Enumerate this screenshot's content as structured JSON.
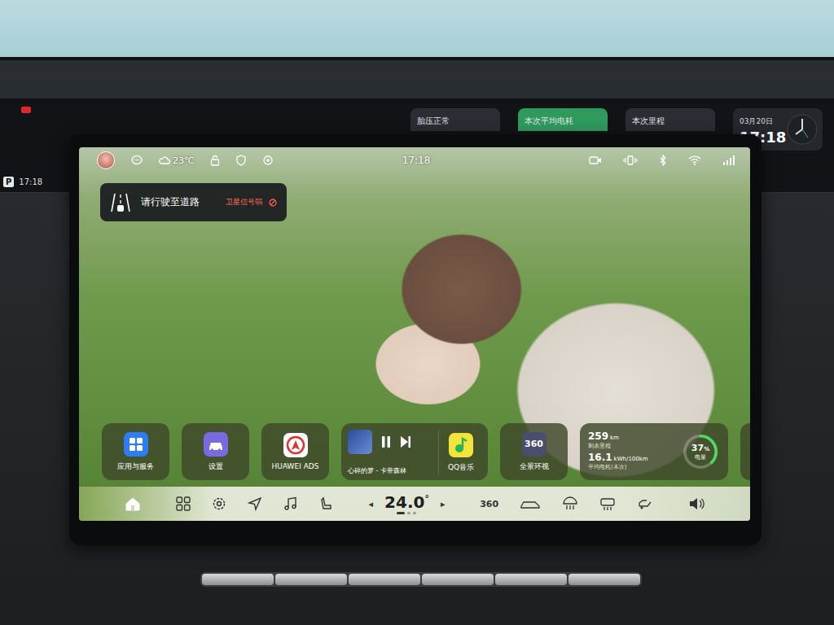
{
  "cluster": {
    "gear": "P",
    "time": "17:18",
    "widgets": [
      {
        "label": "胎压正常",
        "highlight": false
      },
      {
        "label": "本次平均电耗",
        "highlight": true
      },
      {
        "label": "本次里程",
        "highlight": false
      }
    ],
    "date": "03月20日",
    "clock": "17:18"
  },
  "status_bar": {
    "weather": "23℃",
    "time": "17:18"
  },
  "notification": {
    "title": "请行驶至道路",
    "warning": "卫星信号弱"
  },
  "cards": [
    {
      "label": "应用与服务"
    },
    {
      "label": "设置"
    },
    {
      "label": "HUAWEI ADS"
    }
  ],
  "media": {
    "track": "心碎的梦 - 卡带森林",
    "playing": true,
    "app": "QQ音乐"
  },
  "surround": {
    "icon_text": "360",
    "label": "全景环视"
  },
  "battery": {
    "range": "259",
    "range_unit": "km",
    "range_label": "剩余里程",
    "consumption": "16.1",
    "consumption_unit": "kWh/100km",
    "consumption_label": "平均电耗(本次)",
    "percent": "37",
    "percent_unit": "%",
    "percent_label": "电量",
    "level": 0.37
  },
  "dock": {
    "temperature": "24.0",
    "degree": "°",
    "left_arrow": "◂",
    "right_arrow": "▸",
    "page_dots": [
      {
        "selected": true
      },
      {
        "selected": false
      },
      {
        "selected": false
      }
    ],
    "surround_text": "360"
  }
}
